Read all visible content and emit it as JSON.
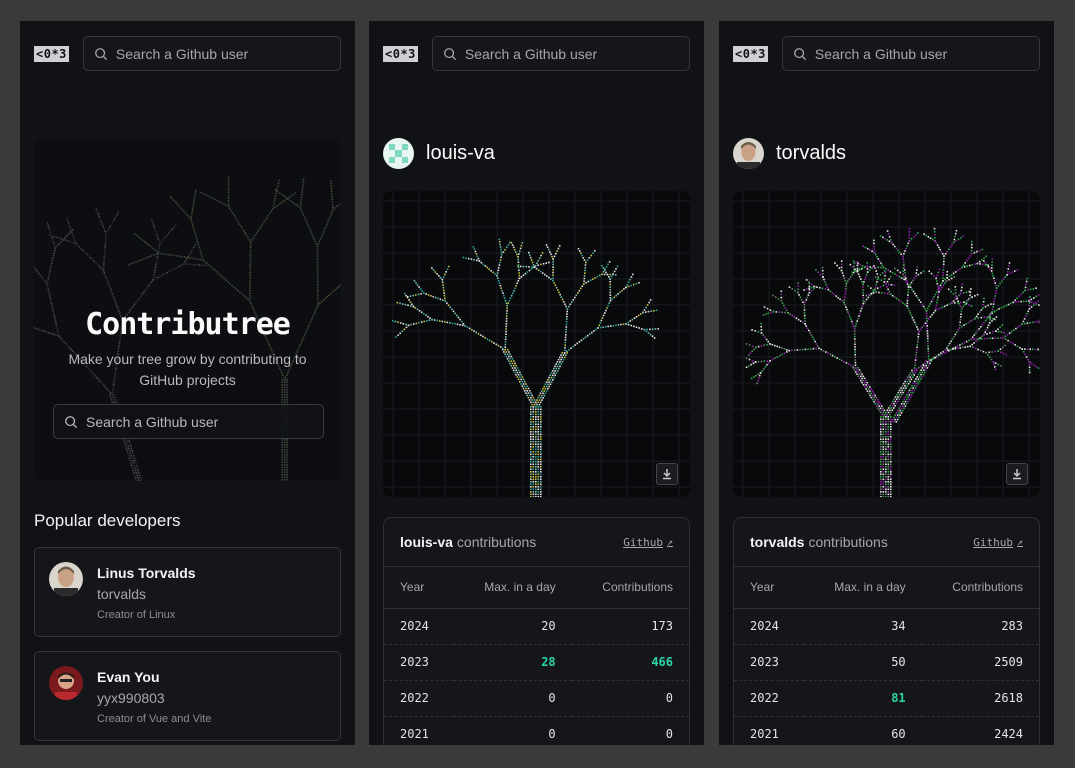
{
  "common": {
    "logo": "<0*3",
    "search_placeholder": "Search a Github user"
  },
  "home": {
    "title": "Contributree",
    "subtitle": "Make your tree grow by contributing to GitHub projects",
    "hero_search_placeholder": "Search a Github user",
    "popular_title": "Popular developers",
    "developers": [
      {
        "name": "Linus Torvalds",
        "login": "torvalds",
        "description": "Creator of Linux",
        "avatar_icon": "linus-avatar-icon"
      },
      {
        "name": "Evan You",
        "login": "yyx990803",
        "description": "Creator of Vue and Vite",
        "avatar_icon": "evan-avatar-icon"
      }
    ]
  },
  "profiles": [
    {
      "username": "louis-va",
      "contributions_suffix": "contributions",
      "github_link": "Github",
      "columns": [
        "Year",
        "Max. in a day",
        "Contributions"
      ],
      "rows": [
        {
          "year": "2024",
          "max": "20",
          "total": "173",
          "highlight": false
        },
        {
          "year": "2023",
          "max": "28",
          "total": "466",
          "highlight": true,
          "highlight_max": true
        },
        {
          "year": "2022",
          "max": "0",
          "total": "0",
          "highlight": false
        },
        {
          "year": "2021",
          "max": "0",
          "total": "0",
          "highlight": false
        }
      ],
      "tree_colors": [
        "#e5e5e5",
        "#2aa29b",
        "#c9c43a",
        "#6fbfae"
      ]
    },
    {
      "username": "torvalds",
      "contributions_suffix": "contributions",
      "github_link": "Github",
      "columns": [
        "Year",
        "Max. in a day",
        "Contributions"
      ],
      "rows": [
        {
          "year": "2024",
          "max": "34",
          "total": "283",
          "highlight": false
        },
        {
          "year": "2023",
          "max": "50",
          "total": "2509",
          "highlight": false
        },
        {
          "year": "2022",
          "max": "81",
          "total": "2618",
          "highlight": false,
          "highlight_max": true
        },
        {
          "year": "2021",
          "max": "60",
          "total": "2424",
          "highlight": false
        }
      ],
      "tree_colors": [
        "#e5e5e5",
        "#8f22a8",
        "#2fa64a",
        "#6b7a6e"
      ]
    }
  ],
  "accent": "#2dd4a8"
}
